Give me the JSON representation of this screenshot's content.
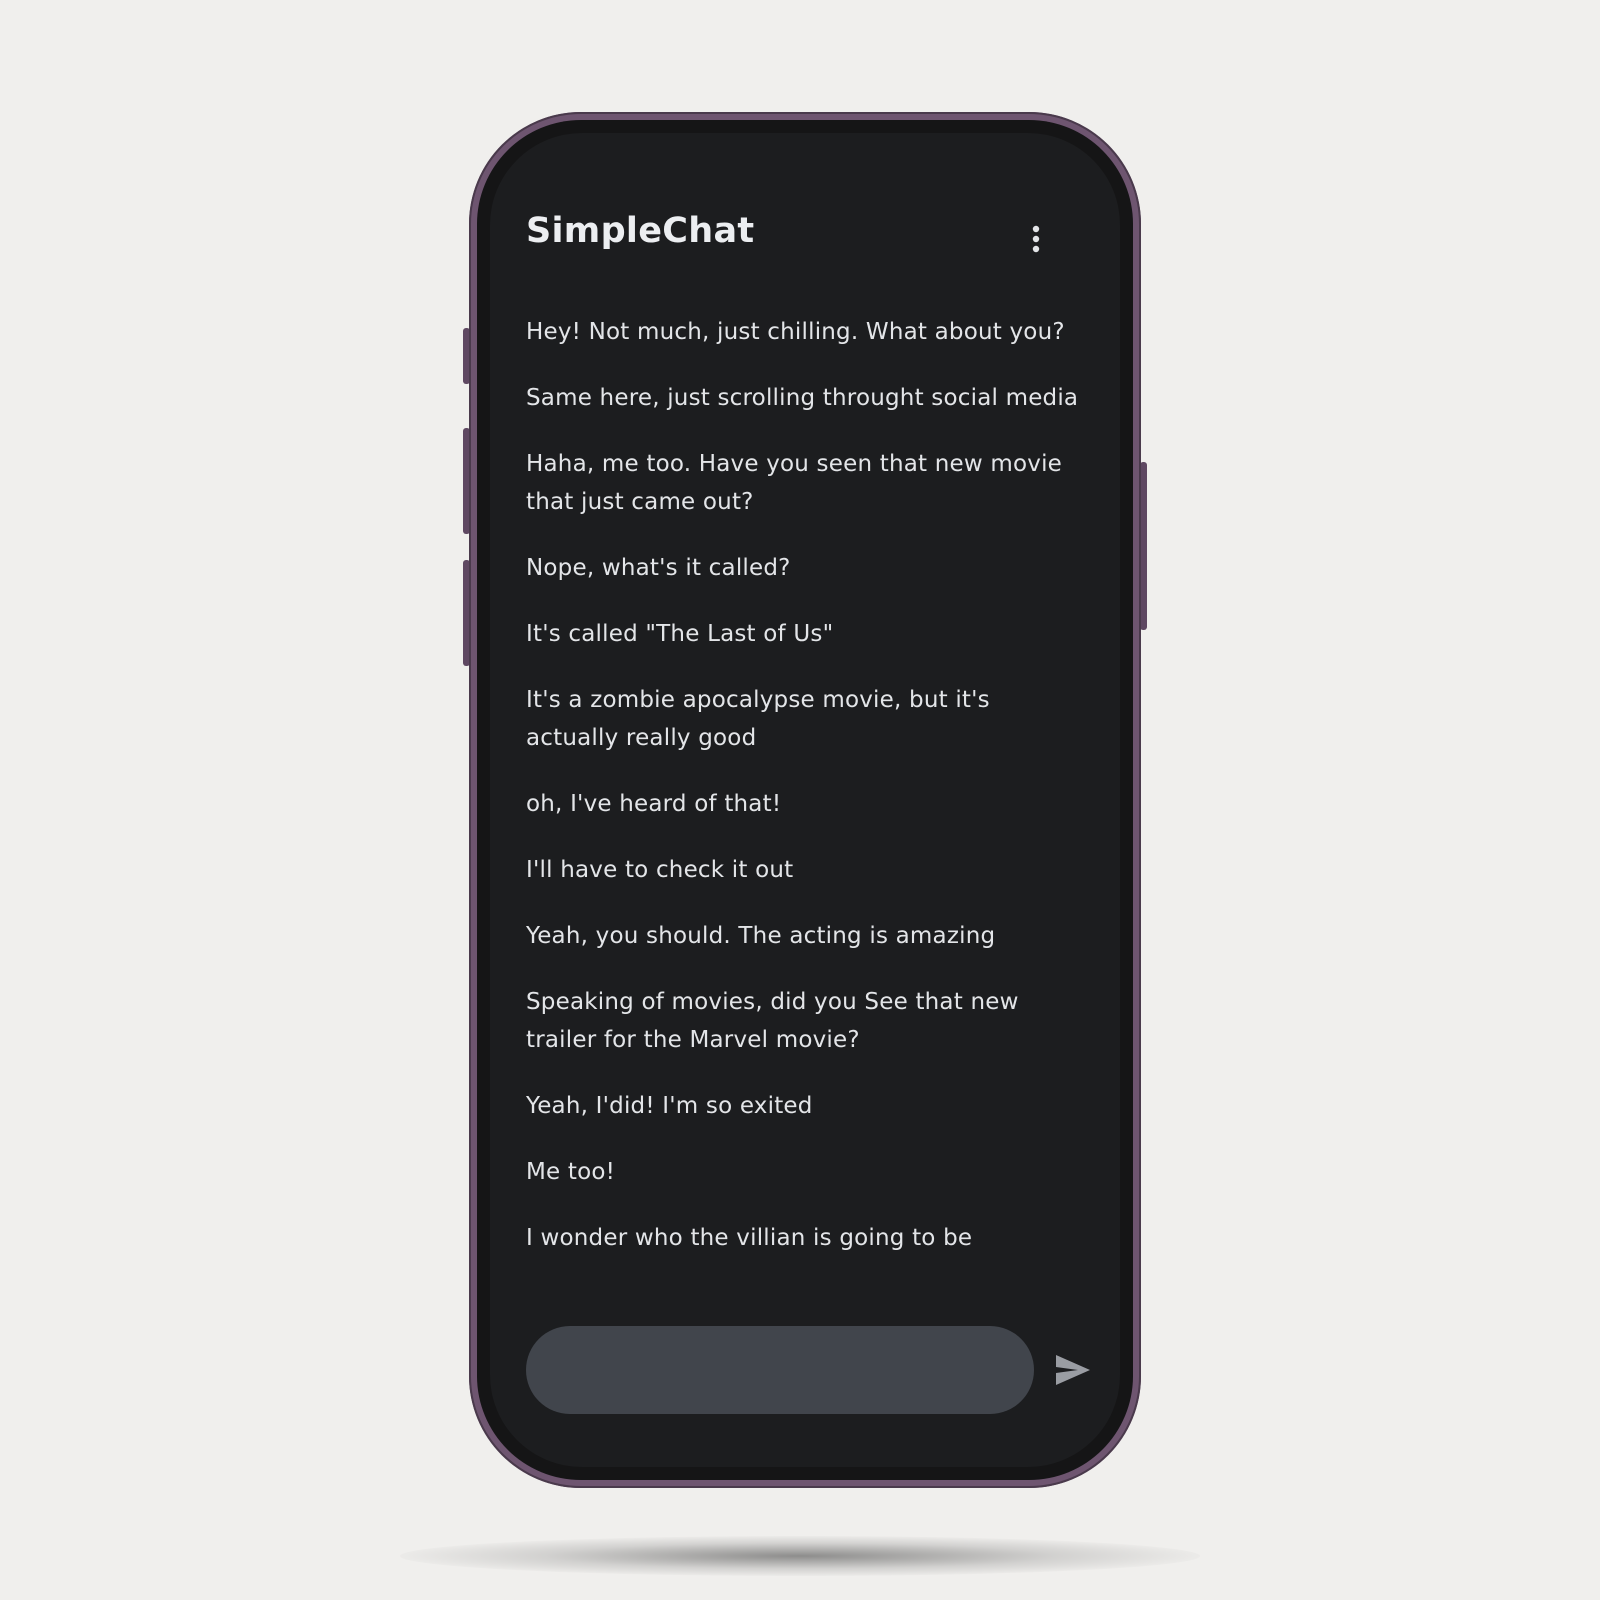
{
  "app": {
    "title": "SimpleChat"
  },
  "header": {
    "menu_icon": "more-vert-icon"
  },
  "messages": [
    "Hey! Not much, just chilling.  What about you?",
    "Same here, just scrolling throught social media",
    "Haha, me too. Have you seen that new movie that just came out?",
    "Nope, what's it called?",
    "It's called \"The Last of Us\"",
    "It's a zombie apocalypse movie, but it's actually really good",
    "oh, I've heard of that!",
    "I'll have to check it out",
    "Yeah, you should.  The acting is amazing",
    "Speaking of movies, did you See that new trailer for the Marvel movie?",
    "Yeah, I'did! I'm so exited",
    "Me too!",
    "I wonder who the villian is going to be"
  ],
  "composer": {
    "value": "",
    "placeholder": "",
    "send_icon": "send-icon"
  },
  "colors": {
    "page_background": "#f0efed",
    "device_frame": "#6e5570",
    "screen_background": "#1c1d1f",
    "text": "#e3e5e8",
    "input_background": "#41454c",
    "send_icon": "#9a9da3"
  }
}
